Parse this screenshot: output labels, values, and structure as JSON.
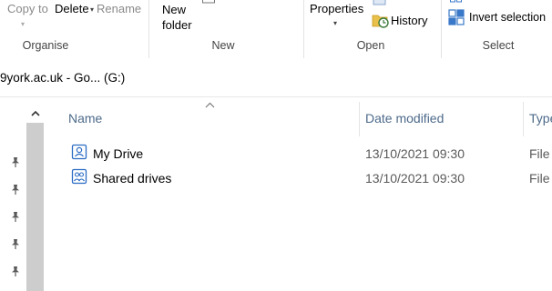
{
  "ribbon": {
    "organise": {
      "copy_to": "Copy to",
      "delete": "Delete",
      "rename": "Rename",
      "group_label": "Organise"
    },
    "new": {
      "new_folder_line1": "New",
      "new_folder_line2": "folder",
      "group_label": "New"
    },
    "open": {
      "properties": "Properties",
      "history": "History",
      "group_label": "Open"
    },
    "select": {
      "invert_selection": "Invert selection",
      "group_label": "Select"
    }
  },
  "address_bar": {
    "path": "9york.ac.uk - Go... (G:)"
  },
  "columns": {
    "name": "Name",
    "date_modified": "Date modified",
    "type": "Type"
  },
  "files": [
    {
      "name": "My Drive",
      "date": "13/10/2021 09:30",
      "type": "File",
      "icon": "drive-folder-icon"
    },
    {
      "name": "Shared drives",
      "date": "13/10/2021 09:30",
      "type": "File",
      "icon": "shared-drive-folder-icon"
    }
  ],
  "colors": {
    "accent": "#2b6cc4",
    "header_text": "#4d6a8a",
    "scroll_thumb": "#cdcdcd"
  }
}
